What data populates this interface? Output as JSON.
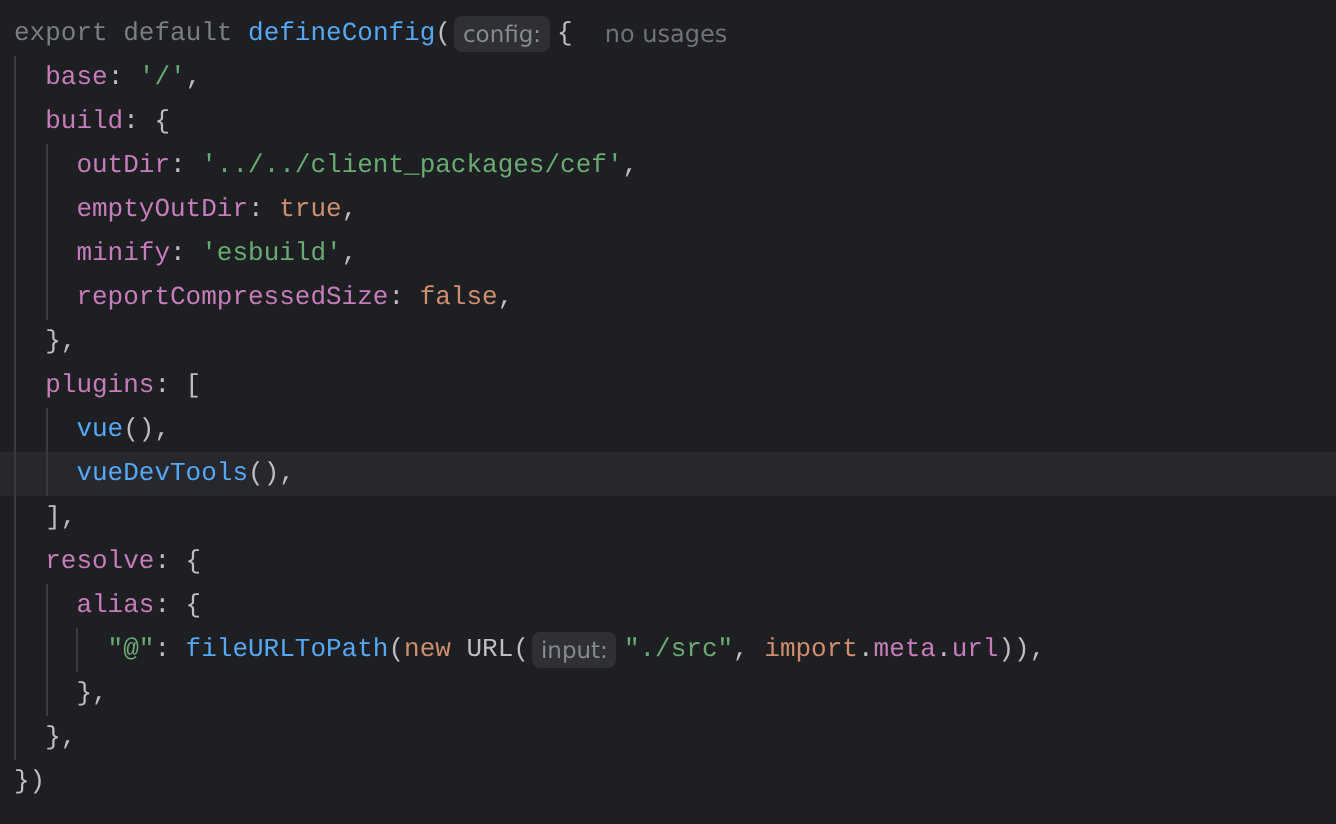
{
  "editor": {
    "lines": [
      {
        "current": false,
        "segments": [
          {
            "kind": "code",
            "tokens": [
              {
                "text": "export default ",
                "kind": "dim"
              },
              {
                "text": "defineConfig",
                "kind": "fn"
              },
              {
                "text": "(",
                "kind": "plain"
              }
            ]
          },
          {
            "kind": "hint",
            "text": "config:"
          },
          {
            "kind": "code",
            "tokens": [
              {
                "text": "{",
                "kind": "plain"
              }
            ]
          },
          {
            "kind": "note",
            "text": "no usages"
          }
        ],
        "children": [
          {
            "current": false,
            "segments": [
              {
                "kind": "code",
                "tokens": [
                  {
                    "text": "base",
                    "kind": "prop"
                  },
                  {
                    "text": ": ",
                    "kind": "plain"
                  },
                  {
                    "text": "'/'",
                    "kind": "str"
                  },
                  {
                    "text": ",",
                    "kind": "plain"
                  }
                ]
              }
            ]
          },
          {
            "current": false,
            "segments": [
              {
                "kind": "code",
                "tokens": [
                  {
                    "text": "build",
                    "kind": "prop"
                  },
                  {
                    "text": ": {",
                    "kind": "plain"
                  }
                ]
              }
            ],
            "children": [
              {
                "current": false,
                "segments": [
                  {
                    "kind": "code",
                    "tokens": [
                      {
                        "text": "outDir",
                        "kind": "prop"
                      },
                      {
                        "text": ": ",
                        "kind": "plain"
                      },
                      {
                        "text": "'../../client_packages/cef'",
                        "kind": "str"
                      },
                      {
                        "text": ",",
                        "kind": "plain"
                      }
                    ]
                  }
                ]
              },
              {
                "current": false,
                "segments": [
                  {
                    "kind": "code",
                    "tokens": [
                      {
                        "text": "emptyOutDir",
                        "kind": "prop"
                      },
                      {
                        "text": ": ",
                        "kind": "plain"
                      },
                      {
                        "text": "true",
                        "kind": "kw"
                      },
                      {
                        "text": ",",
                        "kind": "plain"
                      }
                    ]
                  }
                ]
              },
              {
                "current": false,
                "segments": [
                  {
                    "kind": "code",
                    "tokens": [
                      {
                        "text": "minify",
                        "kind": "prop"
                      },
                      {
                        "text": ": ",
                        "kind": "plain"
                      },
                      {
                        "text": "'esbuild'",
                        "kind": "str"
                      },
                      {
                        "text": ",",
                        "kind": "plain"
                      }
                    ]
                  }
                ]
              },
              {
                "current": false,
                "segments": [
                  {
                    "kind": "code",
                    "tokens": [
                      {
                        "text": "reportCompressedSize",
                        "kind": "prop"
                      },
                      {
                        "text": ": ",
                        "kind": "plain"
                      },
                      {
                        "text": "false",
                        "kind": "kw"
                      },
                      {
                        "text": ",",
                        "kind": "plain"
                      }
                    ]
                  }
                ]
              }
            ]
          },
          {
            "current": false,
            "segments": [
              {
                "kind": "code",
                "tokens": [
                  {
                    "text": "},",
                    "kind": "plain"
                  }
                ]
              }
            ]
          },
          {
            "current": false,
            "segments": [
              {
                "kind": "code",
                "tokens": [
                  {
                    "text": "plugins",
                    "kind": "prop"
                  },
                  {
                    "text": ": [",
                    "kind": "plain"
                  }
                ]
              }
            ],
            "children": [
              {
                "current": false,
                "segments": [
                  {
                    "kind": "code",
                    "tokens": [
                      {
                        "text": "vue",
                        "kind": "fn"
                      },
                      {
                        "text": "(),",
                        "kind": "plain"
                      }
                    ]
                  }
                ]
              },
              {
                "current": true,
                "segments": [
                  {
                    "kind": "code",
                    "tokens": [
                      {
                        "text": "vueDevTools",
                        "kind": "fn"
                      },
                      {
                        "text": "(),",
                        "kind": "plain"
                      }
                    ]
                  }
                ]
              }
            ]
          },
          {
            "current": false,
            "segments": [
              {
                "kind": "code",
                "tokens": [
                  {
                    "text": "],",
                    "kind": "plain"
                  }
                ]
              }
            ]
          },
          {
            "current": false,
            "segments": [
              {
                "kind": "code",
                "tokens": [
                  {
                    "text": "resolve",
                    "kind": "prop"
                  },
                  {
                    "text": ": {",
                    "kind": "plain"
                  }
                ]
              }
            ],
            "children": [
              {
                "current": false,
                "segments": [
                  {
                    "kind": "code",
                    "tokens": [
                      {
                        "text": "alias",
                        "kind": "prop"
                      },
                      {
                        "text": ": {",
                        "kind": "plain"
                      }
                    ]
                  }
                ],
                "children": [
                  {
                    "current": false,
                    "segments": [
                      {
                        "kind": "code",
                        "tokens": [
                          {
                            "text": "\"@\"",
                            "kind": "str"
                          },
                          {
                            "text": ": ",
                            "kind": "plain"
                          },
                          {
                            "text": "fileURLToPath",
                            "kind": "fn"
                          },
                          {
                            "text": "(",
                            "kind": "plain"
                          },
                          {
                            "text": "new ",
                            "kind": "kw"
                          },
                          {
                            "text": "URL(",
                            "kind": "plain"
                          }
                        ]
                      },
                      {
                        "kind": "hint",
                        "text": "input:"
                      },
                      {
                        "kind": "code",
                        "tokens": [
                          {
                            "text": "\"./src\"",
                            "kind": "str"
                          },
                          {
                            "text": ", ",
                            "kind": "plain"
                          },
                          {
                            "text": "import",
                            "kind": "kw"
                          },
                          {
                            "text": ".",
                            "kind": "plain"
                          },
                          {
                            "text": "meta",
                            "kind": "prop"
                          },
                          {
                            "text": ".",
                            "kind": "plain"
                          },
                          {
                            "text": "url",
                            "kind": "prop"
                          },
                          {
                            "text": ")),",
                            "kind": "plain"
                          }
                        ]
                      }
                    ]
                  }
                ]
              },
              {
                "current": false,
                "segments": [
                  {
                    "kind": "code",
                    "tokens": [
                      {
                        "text": "},",
                        "kind": "plain"
                      }
                    ]
                  }
                ]
              }
            ]
          },
          {
            "current": false,
            "segments": [
              {
                "kind": "code",
                "tokens": [
                  {
                    "text": "},",
                    "kind": "plain"
                  }
                ]
              }
            ]
          }
        ]
      },
      {
        "current": false,
        "segments": [
          {
            "kind": "code",
            "tokens": [
              {
                "text": "})",
                "kind": "plain"
              }
            ]
          }
        ]
      }
    ]
  }
}
